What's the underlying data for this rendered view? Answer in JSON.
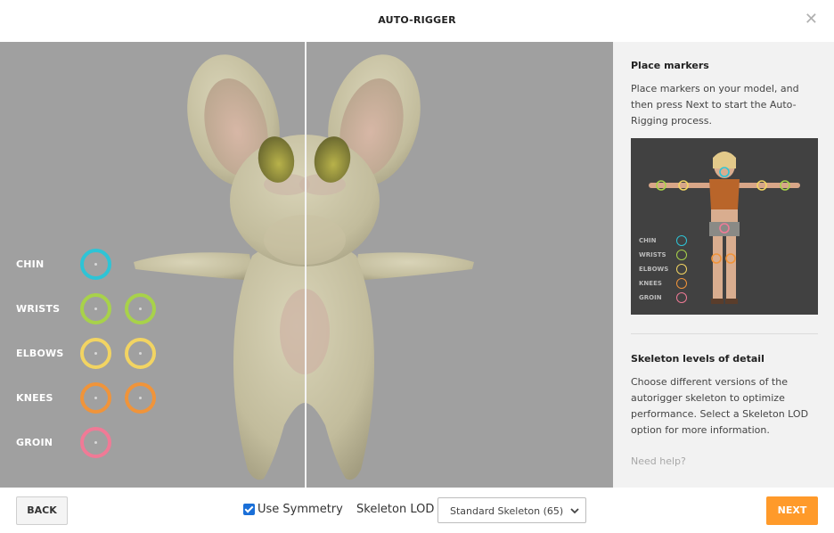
{
  "header": {
    "title": "AUTO-RIGGER"
  },
  "markers": [
    {
      "label": "CHIN",
      "color": "#2ec4d6"
    },
    {
      "label": "WRISTS",
      "color": "#a8d24a"
    },
    {
      "label": "ELBOWS",
      "color": "#f2d462"
    },
    {
      "label": "KNEES",
      "color": "#f0943a"
    },
    {
      "label": "GROIN",
      "color": "#f07a96"
    }
  ],
  "panel": {
    "place_title": "Place markers",
    "place_text": "Place markers on your model, and then press Next to start the Auto-Rigging process.",
    "legend": [
      "CHIN",
      "WRISTS",
      "ELBOWS",
      "KNEES",
      "GROIN"
    ],
    "lod_title": "Skeleton levels of detail",
    "lod_text": "Choose different versions of the autorigger skeleton to optimize performance. Select a Skeleton LOD option for more information.",
    "help": "Need help?"
  },
  "footer": {
    "back": "BACK",
    "use_symmetry": "Use Symmetry",
    "use_symmetry_checked": true,
    "lod_label": "Skeleton LOD",
    "lod_value": "Standard Skeleton (65)",
    "next": "NEXT"
  }
}
